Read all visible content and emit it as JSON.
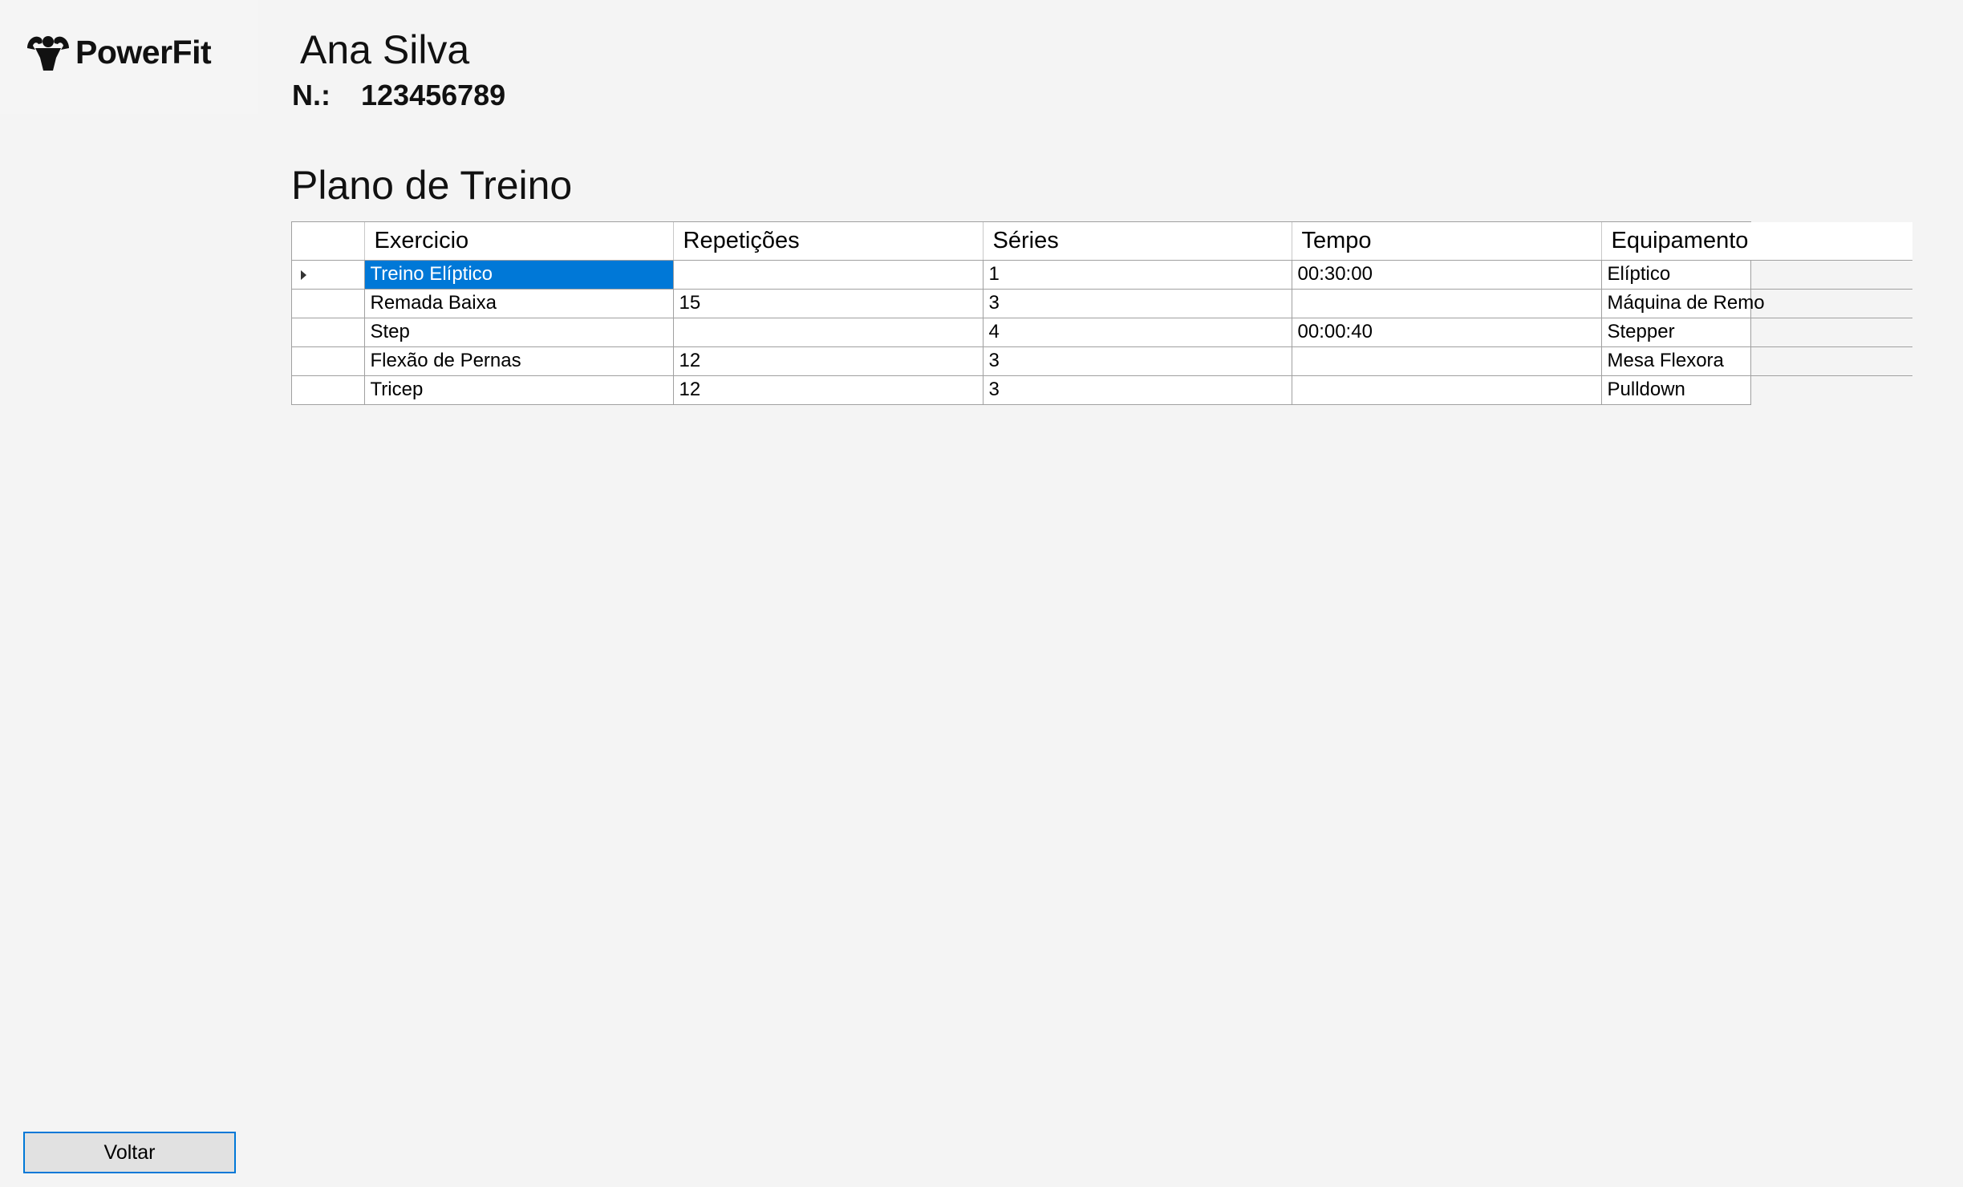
{
  "brand": {
    "logo_icon": "flexed-arms-icon",
    "name": "PowerFit"
  },
  "member": {
    "name": "Ana Silva",
    "number_label": "N.:",
    "number": "123456789"
  },
  "section_title": "Plano de Treino",
  "table": {
    "columns": [
      "Exercicio",
      "Repetições",
      "Séries",
      "Tempo",
      "Equipamento"
    ],
    "rows": [
      {
        "exercicio": "Treino Elíptico",
        "repeticoes": "",
        "series": "1",
        "tempo": "00:30:00",
        "equipamento": "Elíptico"
      },
      {
        "exercicio": "Remada Baixa",
        "repeticoes": "15",
        "series": "3",
        "tempo": "",
        "equipamento": "Máquina de Remo"
      },
      {
        "exercicio": "Step",
        "repeticoes": "",
        "series": "4",
        "tempo": "00:00:40",
        "equipamento": "Stepper"
      },
      {
        "exercicio": "Flexão de Pernas",
        "repeticoes": "12",
        "series": "3",
        "tempo": "",
        "equipamento": "Mesa Flexora"
      },
      {
        "exercicio": "Tricep",
        "repeticoes": "12",
        "series": "3",
        "tempo": "",
        "equipamento": "Pulldown"
      }
    ]
  },
  "back_button": "Voltar",
  "colors": {
    "selection": "#0078d7",
    "background": "#f4f4f4"
  }
}
